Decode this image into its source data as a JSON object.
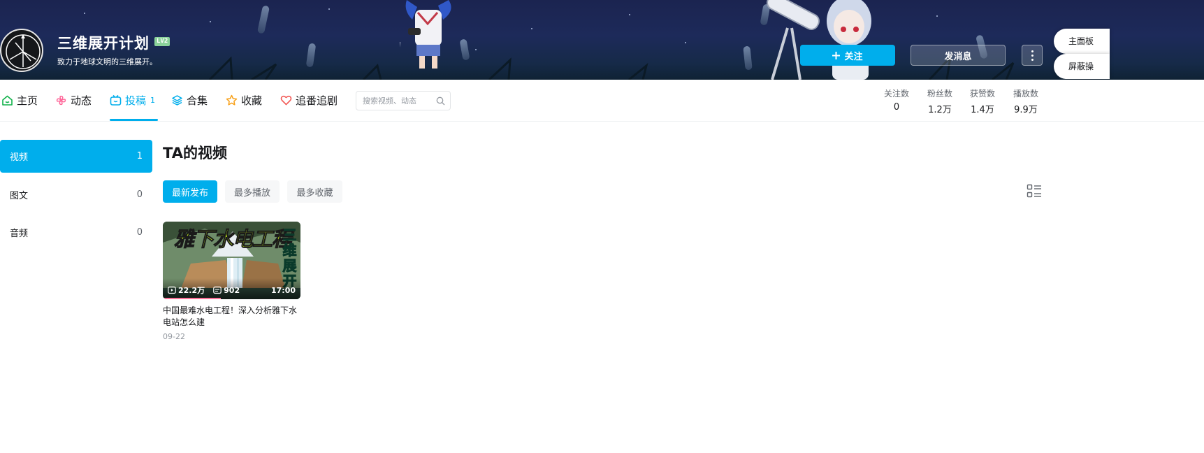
{
  "banner": {
    "username": "三维展开计划",
    "level": "LV2",
    "sign": "致力于地球文明的三维展开。",
    "follow_label": "关注",
    "message_label": "发消息",
    "pills": [
      "主面板",
      "屏蔽操"
    ]
  },
  "nav": {
    "tabs": [
      {
        "label": "主页",
        "icon": "home-icon",
        "color": "#12b24b"
      },
      {
        "label": "动态",
        "icon": "pinwheel-icon",
        "color": "#ff6699"
      },
      {
        "label": "投稿",
        "icon": "tv-icon",
        "color": "#00aeec",
        "count": "1"
      },
      {
        "label": "合集",
        "icon": "layers-icon",
        "color": "#00aeec"
      },
      {
        "label": "收藏",
        "icon": "star-icon",
        "color": "#f8a11a"
      },
      {
        "label": "追番追剧",
        "icon": "heart-icon",
        "color": "#f25d59"
      }
    ],
    "search_placeholder": "搜索视频、动态",
    "stats": [
      {
        "label": "关注数",
        "value": "0"
      },
      {
        "label": "粉丝数",
        "value": "1.2万"
      },
      {
        "label": "获赞数",
        "value": "1.4万"
      },
      {
        "label": "播放数",
        "value": "9.9万"
      }
    ]
  },
  "sidebar": {
    "items": [
      {
        "label": "视频",
        "count": "1"
      },
      {
        "label": "图文",
        "count": "0"
      },
      {
        "label": "音频",
        "count": "0"
      }
    ]
  },
  "content": {
    "title": "TA的视频",
    "sort_options": [
      "最新发布",
      "最多播放",
      "最多收藏"
    ],
    "videos": [
      {
        "thumb_title": "雅下水电工程",
        "thumb_side": "三维展开",
        "plays": "22.2万",
        "danmaku": "902",
        "duration": "17:00",
        "watched_fraction": 0.42,
        "title": "中国最难水电工程！深入分析雅下水电站怎么建",
        "date": "09-22"
      }
    ]
  },
  "colors": {
    "accent": "#00aeec",
    "text": "#18191c",
    "muted": "#61666d",
    "progress": "#fb7299"
  }
}
